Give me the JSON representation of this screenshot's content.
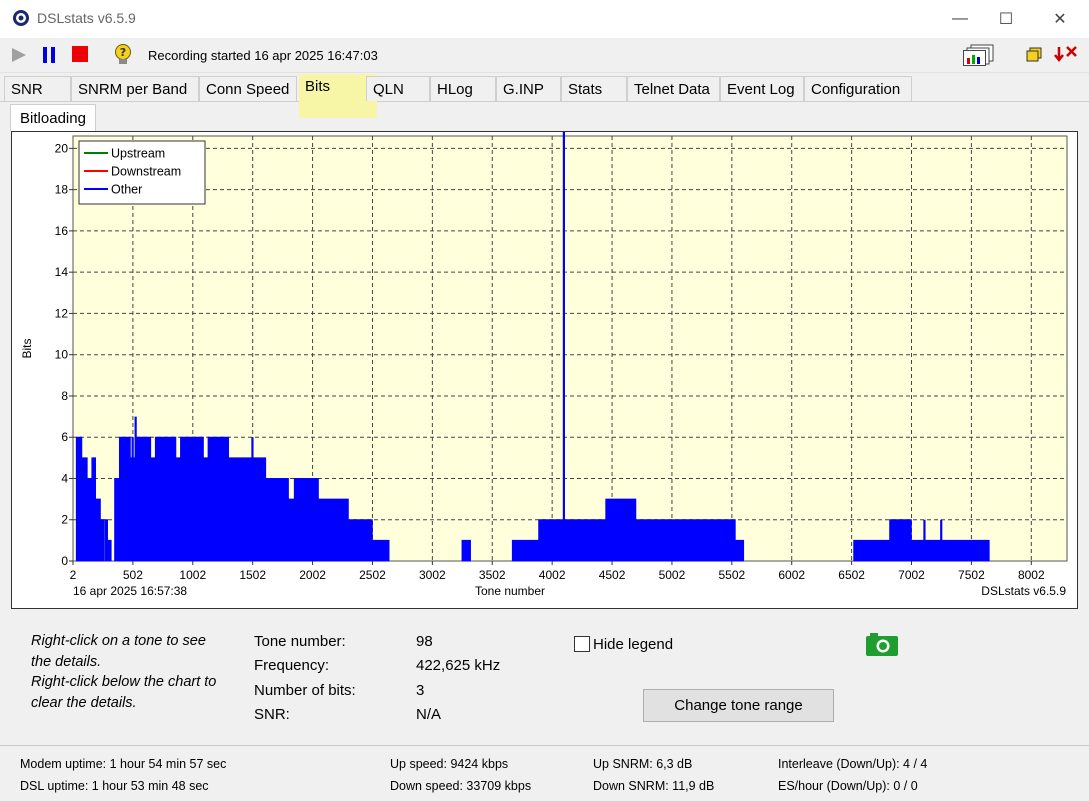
{
  "window": {
    "title": "DSLstats v6.5.9"
  },
  "toolbar": {
    "status": "Recording started 16 apr 2025 16:47:03"
  },
  "tabs": [
    {
      "label": "SNR"
    },
    {
      "label": "SNRM per Band"
    },
    {
      "label": "Conn Speed"
    },
    {
      "label": "Bits"
    },
    {
      "label": "QLN"
    },
    {
      "label": "HLog"
    },
    {
      "label": "G.INP"
    },
    {
      "label": "Stats"
    },
    {
      "label": "Telnet Data"
    },
    {
      "label": "Event Log"
    },
    {
      "label": "Configuration"
    }
  ],
  "active_tab": "Bits",
  "subtab": {
    "label": "Bitloading"
  },
  "chart_data": {
    "type": "area",
    "xlabel": "Tone number",
    "ylabel": "Bits",
    "xlim": [
      2,
      8300
    ],
    "ylim": [
      0,
      20.6
    ],
    "x_ticks": [
      "2",
      "502",
      "1002",
      "1502",
      "2002",
      "2502",
      "3002",
      "3502",
      "4002",
      "4502",
      "5002",
      "5502",
      "6002",
      "6502",
      "7002",
      "7502",
      "8002"
    ],
    "y_ticks": [
      "0",
      "2",
      "4",
      "6",
      "8",
      "10",
      "12",
      "14",
      "16",
      "18",
      "20"
    ],
    "grid": true,
    "legend_position": "top-left",
    "timestamp": "16 apr 2025 16:57:38",
    "watermark": "DSLstats v6.5.9",
    "background": "#ffffdc",
    "legend": [
      {
        "name": "Upstream",
        "color": "#008000"
      },
      {
        "name": "Downstream",
        "color": "#ff0000"
      },
      {
        "name": "Other",
        "color": "#0000ff"
      }
    ],
    "series": [
      {
        "name": "Other",
        "color": "#0000ff",
        "segments": [
          [
            [
              30,
              6
            ],
            [
              75,
              6
            ],
            [
              75,
              5
            ],
            [
              120,
              5
            ],
            [
              120,
              4
            ],
            [
              160,
              4
            ],
            [
              160,
              5
            ],
            [
              190,
              5
            ],
            [
              190,
              3
            ],
            [
              230,
              3
            ],
            [
              230,
              2
            ],
            [
              260,
              2
            ],
            [
              260,
              0
            ]
          ],
          [
            [
              270,
              2
            ],
            [
              290,
              2
            ],
            [
              290,
              1
            ],
            [
              320,
              1
            ],
            [
              320,
              0
            ]
          ],
          [
            [
              350,
              4
            ],
            [
              390,
              4
            ],
            [
              390,
              6
            ],
            [
              480,
              6
            ],
            [
              480,
              5
            ],
            [
              530,
              5
            ],
            [
              530,
              6
            ],
            [
              650,
              6
            ],
            [
              650,
              5
            ],
            [
              690,
              5
            ],
            [
              690,
              6
            ],
            [
              860,
              6
            ],
            [
              860,
              5
            ],
            [
              900,
              5
            ],
            [
              900,
              6
            ],
            [
              1090,
              6
            ],
            [
              1090,
              5
            ],
            [
              1130,
              5
            ],
            [
              1130,
              6
            ],
            [
              1300,
              6
            ],
            [
              1300,
              5
            ],
            [
              1610,
              5
            ],
            [
              1610,
              4
            ],
            [
              1800,
              4
            ],
            [
              1800,
              3
            ],
            [
              1850,
              3
            ],
            [
              1850,
              4
            ],
            [
              2050,
              4
            ],
            [
              2050,
              3
            ],
            [
              2300,
              3
            ],
            [
              2300,
              2
            ],
            [
              2500,
              2
            ],
            [
              2500,
              1
            ],
            [
              2640,
              1
            ],
            [
              2640,
              0
            ]
          ],
          [
            [
              3250,
              1
            ],
            [
              3320,
              1
            ],
            [
              3320,
              0
            ]
          ],
          [
            [
              3670,
              1
            ],
            [
              3890,
              1
            ],
            [
              3890,
              2
            ],
            [
              4120,
              2
            ],
            [
              4120,
              2
            ],
            [
              4450,
              2
            ],
            [
              4450,
              3
            ],
            [
              4700,
              3
            ],
            [
              4700,
              2
            ],
            [
              5530,
              2
            ],
            [
              5530,
              1
            ],
            [
              5600,
              1
            ],
            [
              5600,
              0
            ]
          ],
          [
            [
              6520,
              1
            ],
            [
              6820,
              1
            ],
            [
              6820,
              2
            ],
            [
              7000,
              2
            ],
            [
              7000,
              1
            ],
            [
              7650,
              1
            ],
            [
              7650,
              0
            ]
          ]
        ],
        "spikes": [
          [
            400,
            6
          ],
          [
            500,
            6
          ],
          [
            525,
            7
          ],
          [
            640,
            6
          ],
          [
            960,
            6
          ],
          [
            1500,
            6
          ],
          [
            4100,
            21
          ],
          [
            7110,
            2
          ],
          [
            7250,
            2
          ]
        ]
      }
    ]
  },
  "details": {
    "hint_lines": [
      "Right-click on a tone to see",
      "the details.",
      "Right-click below the chart to",
      "clear the details."
    ],
    "tone_label": "Tone number:",
    "tone_value": "98",
    "freq_label": "Frequency:",
    "freq_value": "422,625 kHz",
    "bits_label": "Number of bits:",
    "bits_value": "3",
    "snr_label": "SNR:",
    "snr_value": "N/A"
  },
  "controls": {
    "hide_legend": "Hide legend",
    "change_tone_range": "Change tone range"
  },
  "status": {
    "modem_uptime": "Modem uptime:  1 hour 54 min 57 sec",
    "dsl_uptime": "DSL uptime:  1 hour 53 min 48 sec",
    "up_speed": "Up speed: 9424 kbps",
    "down_speed": "Down speed: 33709 kbps",
    "up_snrm": "Up SNRM: 6,3 dB",
    "down_snrm": "Down SNRM: 11,9 dB",
    "interleave": "Interleave (Down/Up): 4 / 4",
    "es_hour": "ES/hour (Down/Up): 0 / 0"
  }
}
